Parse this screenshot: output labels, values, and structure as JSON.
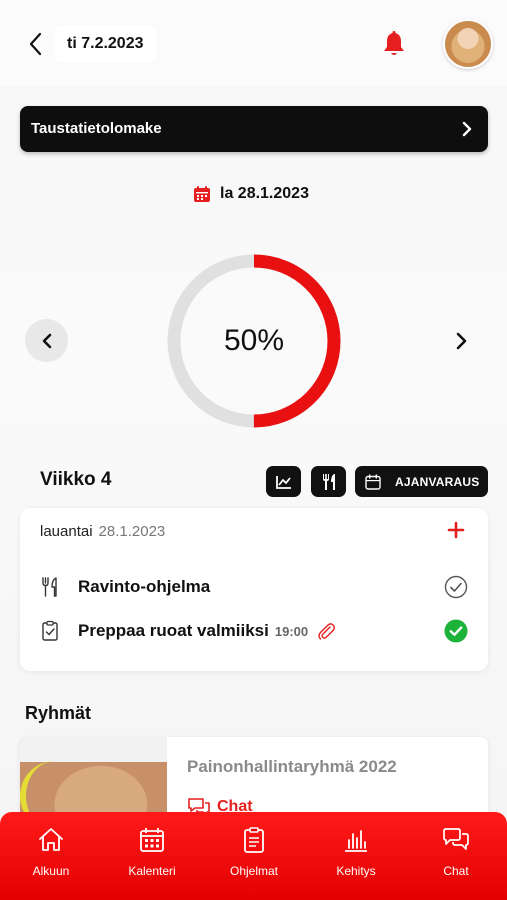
{
  "header": {
    "date": "ti 7.2.2023",
    "back_icon": "chevron-left-icon",
    "notification_icon": "bell-icon"
  },
  "banner": {
    "label": "Taustatietolomake"
  },
  "day_selector": {
    "date": "la 28.1.2023"
  },
  "progress": {
    "label": "50%",
    "value": 0.5,
    "color": "#e81010"
  },
  "week": {
    "title": "Viikko 4",
    "booking_label": "AJANVARAUS"
  },
  "day_card": {
    "day_name": "lauantai",
    "day_date": "28.1.2023",
    "items": [
      {
        "title": "Ravinto-ohjelma",
        "time": "",
        "done": false,
        "icon": "fork-knife-icon"
      },
      {
        "title": "Preppaa ruoat valmiiksi",
        "time": "19:00",
        "done": true,
        "icon": "clipboard-icon"
      }
    ]
  },
  "groups": {
    "title": "Ryhmät",
    "card": {
      "name": "Painonhallintaryhmä 2022",
      "chat_label": "Chat"
    }
  },
  "tabs": [
    {
      "label": "Alkuun",
      "icon": "home-icon"
    },
    {
      "label": "Kalenteri",
      "icon": "calendar-icon"
    },
    {
      "label": "Ohjelmat",
      "icon": "clipboard-icon"
    },
    {
      "label": "Kehitys",
      "icon": "bar-chart-icon"
    },
    {
      "label": "Chat",
      "icon": "chat-bubbles-icon"
    }
  ],
  "colors": {
    "accent": "#e51f1f",
    "dark": "#111111",
    "success": "#1db33b"
  }
}
